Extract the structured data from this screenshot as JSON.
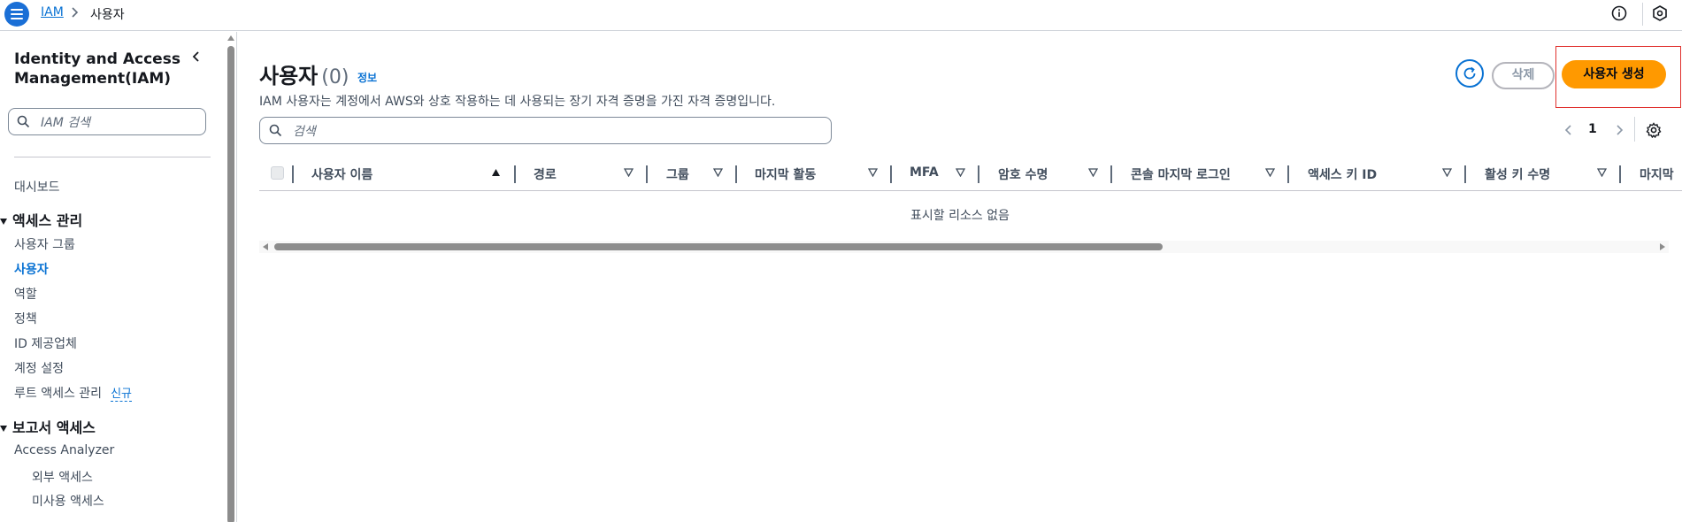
{
  "topbar": {
    "menu_icon": "hamburger-menu-icon",
    "breadcrumb": {
      "root": "IAM",
      "separator": ">",
      "current": "사용자"
    },
    "icons": [
      "info-icon",
      "settings-hexagon-icon"
    ]
  },
  "sidebar": {
    "title": "Identity and Access Management(IAM)",
    "search_placeholder": "IAM 검색",
    "dashboard": "대시보드",
    "access_mgmt": {
      "heading": "액세스 관리",
      "items": [
        "사용자 그룹",
        "사용자",
        "역할",
        "정책",
        "ID 제공업체",
        "계정 설정",
        "루트 액세스 관리"
      ],
      "active_item": "사용자",
      "new_badge": "신규"
    },
    "reports": {
      "heading": "보고서 액세스",
      "items": [
        "Access Analyzer",
        "외부 액세스",
        "미사용 액세스"
      ]
    }
  },
  "main": {
    "title": "사용자",
    "count": "(0)",
    "info_link": "정보",
    "description": "IAM 사용자는 계정에서 AWS와 상호 작용하는 데 사용되는 장기 자격 증명을 가진 자격 증명입니다.",
    "refresh_icon": "refresh-icon",
    "delete_label": "삭제",
    "create_label": "사용자 생성",
    "search_placeholder": "검색",
    "pagination": {
      "current_page": "1"
    },
    "table": {
      "columns": [
        "사용자 이름",
        "경로",
        "그룹",
        "마지막 활동",
        "MFA",
        "암호 수명",
        "콘솔 마지막 로그인",
        "액세스 키 ID",
        "활성 키 수명",
        "마지막"
      ],
      "sort_column": "사용자 이름",
      "sort_direction": "ascending",
      "rows": [],
      "empty_message": "표시할 리소스 없음"
    }
  },
  "colors": {
    "primary_blue": "#0972d3",
    "menu_blue": "#1a6fd6",
    "create_button": "#ff9900",
    "highlight_box": "#e0312e"
  }
}
